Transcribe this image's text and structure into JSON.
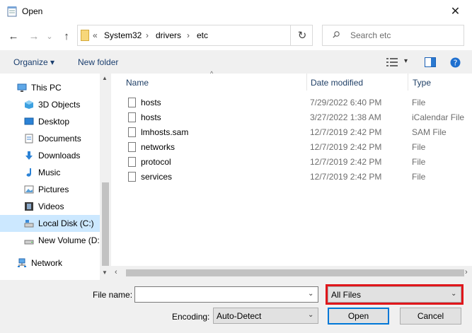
{
  "window": {
    "title": "Open",
    "close_glyph": "✕"
  },
  "nav": {
    "back_glyph": "←",
    "forward_glyph": "→",
    "recent_glyph": "⌄",
    "up_glyph": "↑",
    "refresh_glyph": "↻"
  },
  "address": {
    "overflow": "«",
    "crumbs": [
      "System32",
      "drivers",
      "etc"
    ],
    "separator": "›"
  },
  "search": {
    "placeholder": "Search etc"
  },
  "toolbar": {
    "organize": "Organize ▾",
    "new_folder": "New folder",
    "view_arrow": "▾"
  },
  "sidebar": {
    "items": [
      {
        "label": "This PC",
        "icon": "monitor-icon"
      },
      {
        "label": "3D Objects",
        "icon": "cube-icon"
      },
      {
        "label": "Desktop",
        "icon": "desktop-icon"
      },
      {
        "label": "Documents",
        "icon": "documents-icon"
      },
      {
        "label": "Downloads",
        "icon": "download-icon"
      },
      {
        "label": "Music",
        "icon": "music-icon"
      },
      {
        "label": "Pictures",
        "icon": "pictures-icon"
      },
      {
        "label": "Videos",
        "icon": "videos-icon"
      },
      {
        "label": "Local Disk (C:)",
        "icon": "drive-icon"
      },
      {
        "label": "New Volume (D:",
        "icon": "drive-icon"
      },
      {
        "label": "Network",
        "icon": "network-icon"
      }
    ]
  },
  "columns": {
    "name": "Name",
    "date": "Date modified",
    "type": "Type"
  },
  "files": [
    {
      "name": "hosts",
      "date": "7/29/2022 6:40 PM",
      "type": "File"
    },
    {
      "name": "hosts",
      "date": "3/27/2022 1:38 AM",
      "type": "iCalendar File"
    },
    {
      "name": "lmhosts.sam",
      "date": "12/7/2019 2:42 PM",
      "type": "SAM File"
    },
    {
      "name": "networks",
      "date": "12/7/2019 2:42 PM",
      "type": "File"
    },
    {
      "name": "protocol",
      "date": "12/7/2019 2:42 PM",
      "type": "File"
    },
    {
      "name": "services",
      "date": "12/7/2019 2:42 PM",
      "type": "File"
    }
  ],
  "bottom": {
    "filename_label": "File name:",
    "filename_value": "",
    "filetype_value": "All Files",
    "encoding_label": "Encoding:",
    "encoding_value": "Auto-Detect",
    "open_label": "Open",
    "cancel_label": "Cancel"
  },
  "colors": {
    "highlight": "#e0161b",
    "selection": "#cce8ff",
    "accent": "#0078d7"
  }
}
